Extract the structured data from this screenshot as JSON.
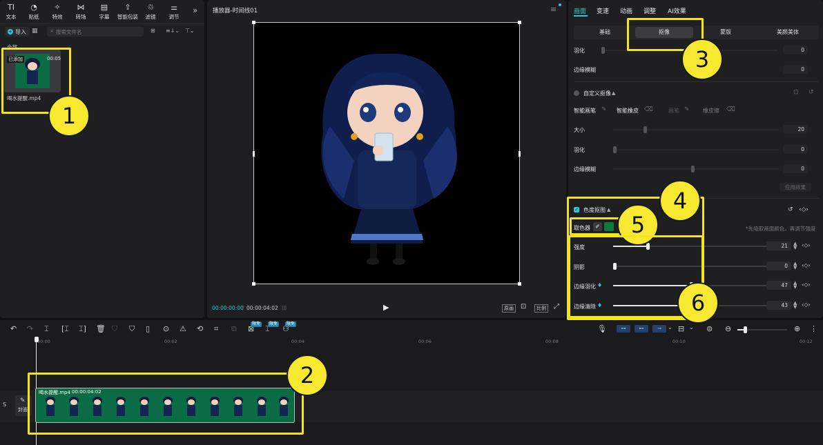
{
  "toolbar": {
    "items": [
      {
        "label": "文本",
        "icon": "TI"
      },
      {
        "label": "贴纸",
        "icon": "◔"
      },
      {
        "label": "特效",
        "icon": "✧"
      },
      {
        "label": "转场",
        "icon": "⋈"
      },
      {
        "label": "字幕",
        "icon": "▤"
      },
      {
        "label": "智能包装",
        "icon": "⇪"
      },
      {
        "label": "滤镜",
        "icon": "♲"
      },
      {
        "label": "调节",
        "icon": "⚌"
      }
    ],
    "more": "»"
  },
  "media": {
    "import_label": "导入",
    "search_placeholder": "搜索文件名",
    "section_label": "全部",
    "added_badge": "已添加",
    "duration": "00:05",
    "file_name": "喝水提醒.mp4"
  },
  "player": {
    "title": "播放器-时间线01",
    "current_time": "00:00:00:00",
    "total_time": "00:00:04:02",
    "btn_original": "原画",
    "btn_ratio": "比例"
  },
  "inspector": {
    "tabs": [
      "画面",
      "变速",
      "动画",
      "调整",
      "AI效果"
    ],
    "subtabs": [
      "基础",
      "抠像",
      "蒙版",
      "美颜美体"
    ],
    "faded_rows": [
      {
        "label": "羽化",
        "value": "0"
      },
      {
        "label": "边缘模糊",
        "value": "0"
      }
    ],
    "custom": {
      "title": "自定义抠像",
      "tools": [
        "智能画笔",
        "智能橡皮",
        "画笔",
        "橡皮擦"
      ],
      "rows": [
        {
          "label": "大小",
          "value": "20"
        },
        {
          "label": "羽化",
          "value": "0"
        },
        {
          "label": "边缘模糊",
          "value": "0"
        }
      ],
      "apply": "应用效果"
    },
    "chroma": {
      "title": "色度抠图",
      "picker_label": "取色器",
      "picker_color": "#0d7a3a",
      "hint": "*先吸取画面颜色，再调节强度",
      "rows": [
        {
          "label": "强度",
          "value": "21",
          "fraction": 0.21
        },
        {
          "label": "阴影",
          "value": "0",
          "fraction": 0
        },
        {
          "label": "边缘羽化",
          "value": "47",
          "fraction": 0.47
        },
        {
          "label": "边缘清除",
          "value": "43",
          "fraction": 0.43
        }
      ]
    }
  },
  "timeline": {
    "ticks": [
      "00:00",
      "00:02",
      "00:04",
      "00:06",
      "00:08",
      "00:10",
      "00:12"
    ],
    "clip_name": "喝水提醒.mp4",
    "clip_duration": "00:00:04:02",
    "cover_label": "封面",
    "track_label": "S",
    "free_badge": "限免"
  },
  "annotations": [
    "1",
    "2",
    "3",
    "4",
    "5",
    "6"
  ],
  "colors": {
    "accent": "#2ec7d6",
    "highlight": "#f2e51c",
    "chroma_green": "#0a6b44"
  }
}
